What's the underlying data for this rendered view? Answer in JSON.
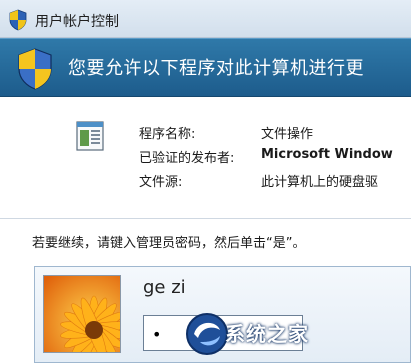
{
  "window": {
    "title": "用户帐户控制"
  },
  "banner": {
    "message": "您要允许以下程序对此计算机进行更"
  },
  "program": {
    "name_label": "程序名称:",
    "name_value": "文件操作",
    "publisher_label": "已验证的发布者:",
    "publisher_value": "Microsoft Window",
    "source_label": "文件源:",
    "source_value": "此计算机上的硬盘驱"
  },
  "prompt": {
    "text": "若要继续，请键入管理员密码，然后单击“是”。"
  },
  "credential": {
    "username": "ge zi",
    "password_masked": "•"
  },
  "watermark": {
    "text": "系统之家"
  },
  "colors": {
    "banner": "#1d5c8c",
    "titlebar": "#dbe6f1",
    "accent": "#2f79a9"
  },
  "icons": [
    "uac-shield-icon",
    "program-window-icon",
    "user-avatar-flower",
    "watermark-logo-icon"
  ]
}
